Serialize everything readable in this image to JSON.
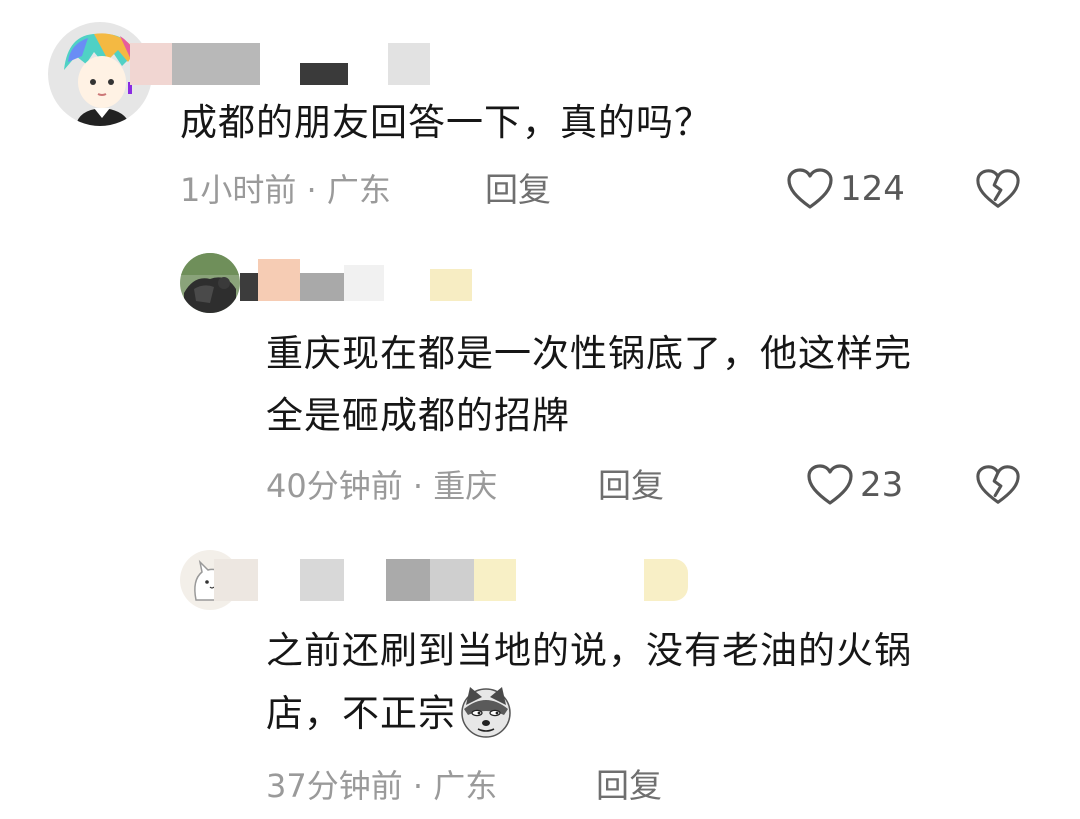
{
  "comments": [
    {
      "text": "成都的朋友回答一下，真的吗？",
      "meta": "1小时前 · 广东",
      "reply_label": "回复",
      "likes": "124"
    },
    {
      "text_line1": "重庆现在都是一次性锅底了，他这样完",
      "text_line2": "全是砸成都的招牌",
      "meta": "40分钟前 · 重庆",
      "reply_label": "回复",
      "likes": "23"
    },
    {
      "text_line1": "之前还刷到当地的说，没有老油的火锅",
      "text_line2": "店，不正宗",
      "emoji": "doge-emoji",
      "meta": "37分钟前 · 广东",
      "reply_label": "回复"
    }
  ],
  "colors": {
    "text": "#161616",
    "meta": "#9a9a9a",
    "reply": "#6f6f6f",
    "icon": "#555555"
  },
  "icons": {
    "like": "heart-outline-icon",
    "dislike": "broken-heart-icon"
  }
}
